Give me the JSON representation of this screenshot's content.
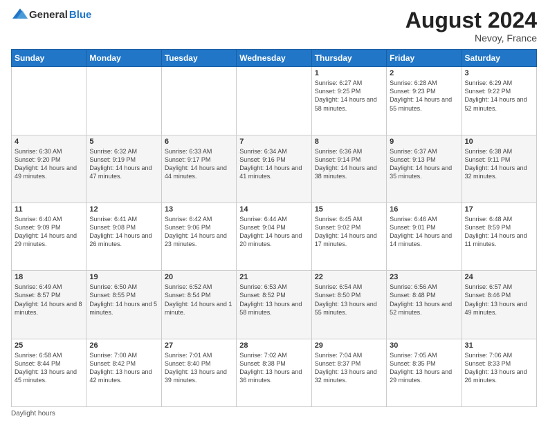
{
  "header": {
    "logo_general": "General",
    "logo_blue": "Blue",
    "month_year": "August 2024",
    "location": "Nevoy, France"
  },
  "days_of_week": [
    "Sunday",
    "Monday",
    "Tuesday",
    "Wednesday",
    "Thursday",
    "Friday",
    "Saturday"
  ],
  "footer": {
    "label": "Daylight hours"
  },
  "weeks": [
    [
      {
        "day": "",
        "sunrise": "",
        "sunset": "",
        "daylight": ""
      },
      {
        "day": "",
        "sunrise": "",
        "sunset": "",
        "daylight": ""
      },
      {
        "day": "",
        "sunrise": "",
        "sunset": "",
        "daylight": ""
      },
      {
        "day": "",
        "sunrise": "",
        "sunset": "",
        "daylight": ""
      },
      {
        "day": "1",
        "sunrise": "Sunrise: 6:27 AM",
        "sunset": "Sunset: 9:25 PM",
        "daylight": "Daylight: 14 hours and 58 minutes."
      },
      {
        "day": "2",
        "sunrise": "Sunrise: 6:28 AM",
        "sunset": "Sunset: 9:23 PM",
        "daylight": "Daylight: 14 hours and 55 minutes."
      },
      {
        "day": "3",
        "sunrise": "Sunrise: 6:29 AM",
        "sunset": "Sunset: 9:22 PM",
        "daylight": "Daylight: 14 hours and 52 minutes."
      }
    ],
    [
      {
        "day": "4",
        "sunrise": "Sunrise: 6:30 AM",
        "sunset": "Sunset: 9:20 PM",
        "daylight": "Daylight: 14 hours and 49 minutes."
      },
      {
        "day": "5",
        "sunrise": "Sunrise: 6:32 AM",
        "sunset": "Sunset: 9:19 PM",
        "daylight": "Daylight: 14 hours and 47 minutes."
      },
      {
        "day": "6",
        "sunrise": "Sunrise: 6:33 AM",
        "sunset": "Sunset: 9:17 PM",
        "daylight": "Daylight: 14 hours and 44 minutes."
      },
      {
        "day": "7",
        "sunrise": "Sunrise: 6:34 AM",
        "sunset": "Sunset: 9:16 PM",
        "daylight": "Daylight: 14 hours and 41 minutes."
      },
      {
        "day": "8",
        "sunrise": "Sunrise: 6:36 AM",
        "sunset": "Sunset: 9:14 PM",
        "daylight": "Daylight: 14 hours and 38 minutes."
      },
      {
        "day": "9",
        "sunrise": "Sunrise: 6:37 AM",
        "sunset": "Sunset: 9:13 PM",
        "daylight": "Daylight: 14 hours and 35 minutes."
      },
      {
        "day": "10",
        "sunrise": "Sunrise: 6:38 AM",
        "sunset": "Sunset: 9:11 PM",
        "daylight": "Daylight: 14 hours and 32 minutes."
      }
    ],
    [
      {
        "day": "11",
        "sunrise": "Sunrise: 6:40 AM",
        "sunset": "Sunset: 9:09 PM",
        "daylight": "Daylight: 14 hours and 29 minutes."
      },
      {
        "day": "12",
        "sunrise": "Sunrise: 6:41 AM",
        "sunset": "Sunset: 9:08 PM",
        "daylight": "Daylight: 14 hours and 26 minutes."
      },
      {
        "day": "13",
        "sunrise": "Sunrise: 6:42 AM",
        "sunset": "Sunset: 9:06 PM",
        "daylight": "Daylight: 14 hours and 23 minutes."
      },
      {
        "day": "14",
        "sunrise": "Sunrise: 6:44 AM",
        "sunset": "Sunset: 9:04 PM",
        "daylight": "Daylight: 14 hours and 20 minutes."
      },
      {
        "day": "15",
        "sunrise": "Sunrise: 6:45 AM",
        "sunset": "Sunset: 9:02 PM",
        "daylight": "Daylight: 14 hours and 17 minutes."
      },
      {
        "day": "16",
        "sunrise": "Sunrise: 6:46 AM",
        "sunset": "Sunset: 9:01 PM",
        "daylight": "Daylight: 14 hours and 14 minutes."
      },
      {
        "day": "17",
        "sunrise": "Sunrise: 6:48 AM",
        "sunset": "Sunset: 8:59 PM",
        "daylight": "Daylight: 14 hours and 11 minutes."
      }
    ],
    [
      {
        "day": "18",
        "sunrise": "Sunrise: 6:49 AM",
        "sunset": "Sunset: 8:57 PM",
        "daylight": "Daylight: 14 hours and 8 minutes."
      },
      {
        "day": "19",
        "sunrise": "Sunrise: 6:50 AM",
        "sunset": "Sunset: 8:55 PM",
        "daylight": "Daylight: 14 hours and 5 minutes."
      },
      {
        "day": "20",
        "sunrise": "Sunrise: 6:52 AM",
        "sunset": "Sunset: 8:54 PM",
        "daylight": "Daylight: 14 hours and 1 minute."
      },
      {
        "day": "21",
        "sunrise": "Sunrise: 6:53 AM",
        "sunset": "Sunset: 8:52 PM",
        "daylight": "Daylight: 13 hours and 58 minutes."
      },
      {
        "day": "22",
        "sunrise": "Sunrise: 6:54 AM",
        "sunset": "Sunset: 8:50 PM",
        "daylight": "Daylight: 13 hours and 55 minutes."
      },
      {
        "day": "23",
        "sunrise": "Sunrise: 6:56 AM",
        "sunset": "Sunset: 8:48 PM",
        "daylight": "Daylight: 13 hours and 52 minutes."
      },
      {
        "day": "24",
        "sunrise": "Sunrise: 6:57 AM",
        "sunset": "Sunset: 8:46 PM",
        "daylight": "Daylight: 13 hours and 49 minutes."
      }
    ],
    [
      {
        "day": "25",
        "sunrise": "Sunrise: 6:58 AM",
        "sunset": "Sunset: 8:44 PM",
        "daylight": "Daylight: 13 hours and 45 minutes."
      },
      {
        "day": "26",
        "sunrise": "Sunrise: 7:00 AM",
        "sunset": "Sunset: 8:42 PM",
        "daylight": "Daylight: 13 hours and 42 minutes."
      },
      {
        "day": "27",
        "sunrise": "Sunrise: 7:01 AM",
        "sunset": "Sunset: 8:40 PM",
        "daylight": "Daylight: 13 hours and 39 minutes."
      },
      {
        "day": "28",
        "sunrise": "Sunrise: 7:02 AM",
        "sunset": "Sunset: 8:38 PM",
        "daylight": "Daylight: 13 hours and 36 minutes."
      },
      {
        "day": "29",
        "sunrise": "Sunrise: 7:04 AM",
        "sunset": "Sunset: 8:37 PM",
        "daylight": "Daylight: 13 hours and 32 minutes."
      },
      {
        "day": "30",
        "sunrise": "Sunrise: 7:05 AM",
        "sunset": "Sunset: 8:35 PM",
        "daylight": "Daylight: 13 hours and 29 minutes."
      },
      {
        "day": "31",
        "sunrise": "Sunrise: 7:06 AM",
        "sunset": "Sunset: 8:33 PM",
        "daylight": "Daylight: 13 hours and 26 minutes."
      }
    ]
  ]
}
